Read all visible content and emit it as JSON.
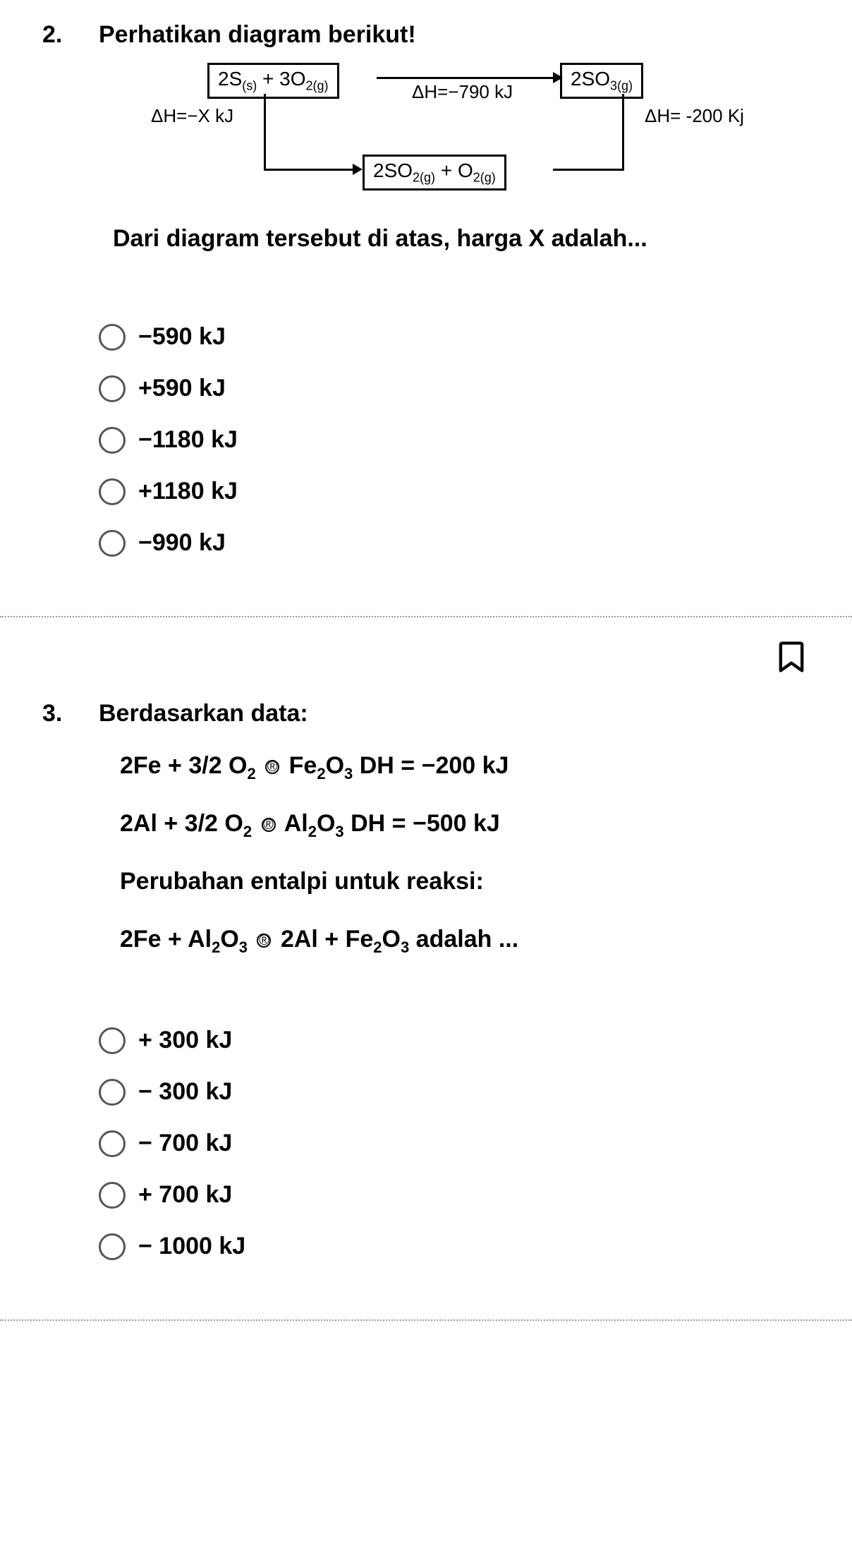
{
  "q2": {
    "number": "2.",
    "title": "Perhatikan diagram berikut!",
    "diagram": {
      "box_left": "2S(s) + 3O2(g)",
      "box_right": "2SO3(g)",
      "box_bottom": "2SO2(g) + O2(g)",
      "top_arrow_label": "ΔH=−790 kJ",
      "left_label": "ΔH=−X kJ",
      "right_label": "ΔH= -200 Kj"
    },
    "subtext": "Dari diagram tersebut di atas, harga X adalah...",
    "options": [
      "−590 kJ",
      "+590 kJ",
      "−1180 kJ",
      "+1180 kJ",
      "−990 kJ"
    ]
  },
  "q3": {
    "number": "3.",
    "title": "Berdasarkan data:",
    "lines": {
      "l1a": "2Fe + 3/2 O",
      "l1b": " Fe",
      "l1c": "O",
      "l1d": "   DH = −200 kJ",
      "l2a": "2Al + 3/2 O",
      "l2b": " Al",
      "l2c": "O",
      "l2d": "    DH = −500 kJ",
      "l3": "Perubahan entalpi untuk reaksi:",
      "l4a": "2Fe + Al",
      "l4b": "O",
      "l4c": " 2Al + Fe",
      "l4d": "O",
      "l4e": " adalah ..."
    },
    "options": [
      "+ 300 kJ",
      "− 300 kJ",
      "− 700 kJ",
      "+ 700 kJ",
      "− 1000 kJ"
    ]
  }
}
